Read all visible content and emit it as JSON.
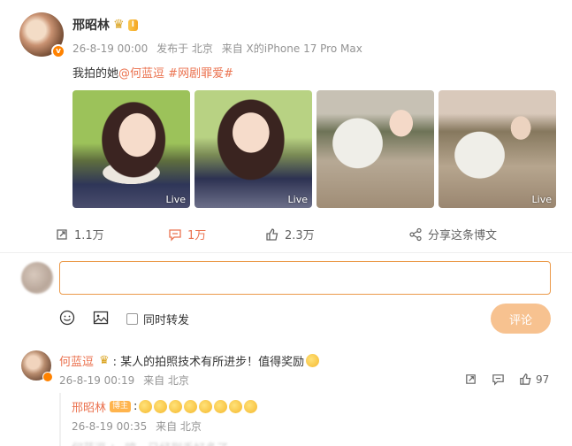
{
  "post": {
    "username": "邢昭林",
    "vip_label": "I",
    "time": "26-8-19 00:00",
    "source_prefix": "发布于 北京",
    "device": "来自 X的iPhone 17 Pro Max",
    "text_prefix": "我拍的她",
    "mention": "@何蓝逗",
    "topic": "#网剧罪爱#",
    "photos": [
      {
        "live": "Live"
      },
      {
        "live": "Live"
      },
      {
        "live": ""
      },
      {
        "live": "Live"
      }
    ]
  },
  "actions": {
    "repost_count": "1.1万",
    "comment_count": "1万",
    "like_count": "2.3万",
    "share_label": "分享这条博文"
  },
  "composer": {
    "placeholder": "",
    "sync_label": "同时转发",
    "submit_label": "评论"
  },
  "comment1": {
    "name": "何蓝逗",
    "text": ": 某人的拍照技术有所进步！值得奖励",
    "time": "26-8-19 00:19",
    "location": "来自 北京",
    "like_count": "97"
  },
  "reply1": {
    "name": "邢昭林",
    "host_tag": "博主",
    "text": ":",
    "time": "26-8-19 00:35",
    "location": "来自 北京"
  },
  "reply2": {
    "text": "何蓝逗 ： 哼，已经到手好多了"
  },
  "colors": {
    "accent": "#eb7350",
    "submit_bg": "#f7c290",
    "input_border": "#eb9a4a"
  }
}
